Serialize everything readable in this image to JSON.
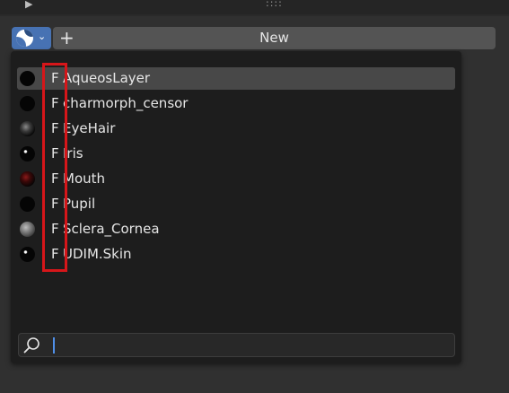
{
  "header": {
    "expand_icon": "triangle-right-icon",
    "drag_handle": "::::"
  },
  "material_selector": {
    "icon": "material-sphere-icon",
    "dropdown_icon": "chevron-down-icon"
  },
  "new_button": {
    "icon": "plus-icon",
    "label": "New"
  },
  "popup": {
    "fake_user_label": "F",
    "materials": [
      {
        "name": "AqueosLayer",
        "active": true
      },
      {
        "name": "charmorph_censor"
      },
      {
        "name": "EyeHair"
      },
      {
        "name": "Iris"
      },
      {
        "name": "Mouth"
      },
      {
        "name": "Pupil"
      },
      {
        "name": "Sclera_Cornea"
      },
      {
        "name": "UDIM.Skin"
      }
    ],
    "search": {
      "icon": "search-icon",
      "value": "",
      "placeholder": ""
    }
  },
  "colors": {
    "accent": "#4772b3",
    "highlight_box": "#d6161a",
    "caret": "#4f8fe8"
  }
}
